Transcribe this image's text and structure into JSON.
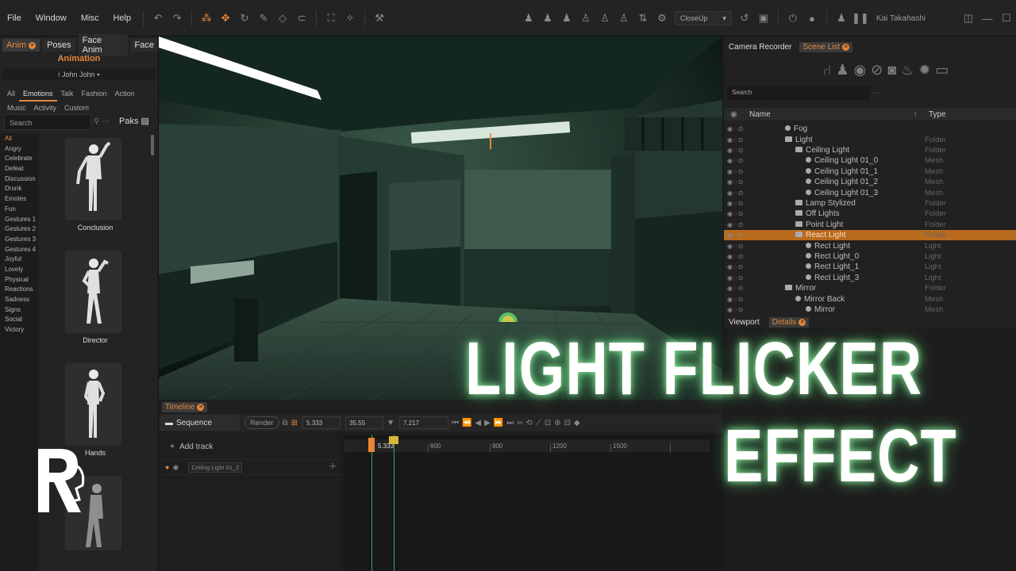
{
  "menubar": {
    "items": [
      "File",
      "Window",
      "Misc",
      "Help"
    ],
    "camera_select": "CloseUp",
    "username": "Kai Takahashi"
  },
  "left_panel": {
    "tabs": [
      "Anim",
      "Poses",
      "Face Anim",
      "Face"
    ],
    "active_tab": "Anim",
    "title": "Animation",
    "character": "John John",
    "category_tabs": [
      "All",
      "Emotions",
      "Talk",
      "Fashion",
      "Action",
      "Music",
      "Activity",
      "Custom"
    ],
    "active_category": "Emotions",
    "search_placeholder": "Search",
    "paks_label": "Paks",
    "list": [
      "All",
      "Angry",
      "Celebrate",
      "Defeat",
      "Discussion",
      "Drunk",
      "Emotes",
      "Fun",
      "Gestures 1",
      "Gestures 2",
      "Gestures 3",
      "Gestures 4",
      "Joyful",
      "Lovely",
      "Physical",
      "Reactions",
      "Sadness",
      "Signs",
      "Social",
      "Victory"
    ],
    "poses": [
      "Conclusion",
      "Director",
      "Hands"
    ]
  },
  "timeline": {
    "tab": "Timeline",
    "sequence": "Sequence",
    "render_label": "Render",
    "field_a": "5.333",
    "field_b": "35.55",
    "field_c": "7.217",
    "add_track": "Add track",
    "track_name": "Ceiling Light 01_2",
    "playhead_label": "5.333",
    "ruler_marks": [
      "600",
      "900",
      "1200",
      "1500"
    ]
  },
  "right_panel": {
    "tabs": [
      "Camera Recorder",
      "Scene List"
    ],
    "active_tab": "Scene List",
    "search_placeholder": "Search",
    "col_name": "Name",
    "col_type": "Type",
    "rows": [
      {
        "name": "Fog",
        "type": "",
        "indent": 1,
        "kind": "dot"
      },
      {
        "name": "Light",
        "type": "Folder",
        "indent": 1,
        "kind": "folder"
      },
      {
        "name": "Ceiling Light",
        "type": "Folder",
        "indent": 2,
        "kind": "folder"
      },
      {
        "name": "Ceiling Light 01_0",
        "type": "Mesh",
        "indent": 3,
        "kind": "dot"
      },
      {
        "name": "Ceiling Light 01_1",
        "type": "Mesh",
        "indent": 3,
        "kind": "dot"
      },
      {
        "name": "Ceiling Light 01_2",
        "type": "Mesh",
        "indent": 3,
        "kind": "dot"
      },
      {
        "name": "Ceiling Light 01_3",
        "type": "Mesh",
        "indent": 3,
        "kind": "dot"
      },
      {
        "name": "Lamp Stylized",
        "type": "Folder",
        "indent": 2,
        "kind": "folder"
      },
      {
        "name": "Off Lights",
        "type": "Folder",
        "indent": 2,
        "kind": "folder"
      },
      {
        "name": "Point Light",
        "type": "Folder",
        "indent": 2,
        "kind": "folder"
      },
      {
        "name": "React Light",
        "type": "Folder",
        "indent": 2,
        "kind": "folder",
        "selected": true
      },
      {
        "name": "Rect Light",
        "type": "Light",
        "indent": 3,
        "kind": "dot"
      },
      {
        "name": "Rect Light_0",
        "type": "Light",
        "indent": 3,
        "kind": "dot"
      },
      {
        "name": "Rect Light_1",
        "type": "Light",
        "indent": 3,
        "kind": "dot"
      },
      {
        "name": "Rect Light_3",
        "type": "Light",
        "indent": 3,
        "kind": "dot"
      },
      {
        "name": "Mirror",
        "type": "Folder",
        "indent": 1,
        "kind": "folder"
      },
      {
        "name": "Mirror Back",
        "type": "Mesh",
        "indent": 2,
        "kind": "dot"
      },
      {
        "name": "Mirror",
        "type": "Mesh",
        "indent": 3,
        "kind": "dot"
      }
    ],
    "bottom_tabs": [
      "Viewport",
      "Details"
    ],
    "bottom_active": "Details"
  },
  "overlay": {
    "line1": "LIGHT FLICKER",
    "line2": "EFFECT"
  },
  "colors": {
    "accent": "#e8873a",
    "selected_row": "#b86a1d",
    "playhead": "#3aa85a"
  }
}
